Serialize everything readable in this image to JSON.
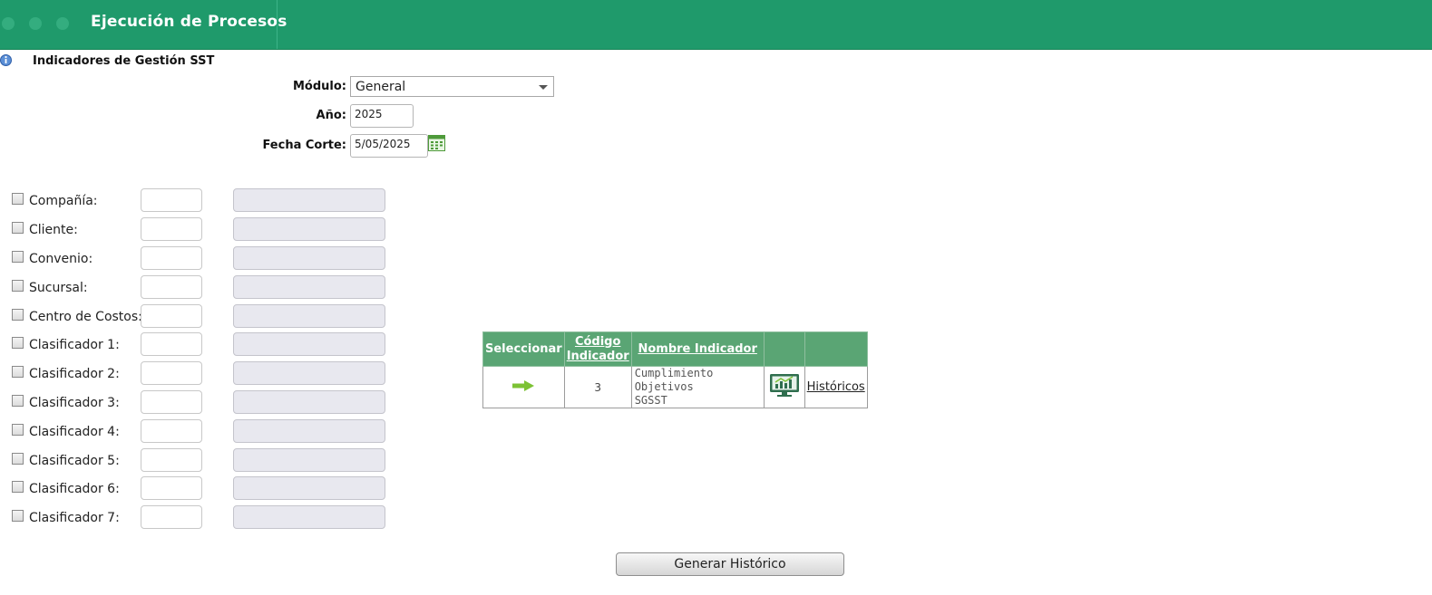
{
  "header": {
    "title": "Ejecución de Procesos"
  },
  "section": {
    "title": "Indicadores de Gestión SST"
  },
  "form": {
    "modulo_label": "Módulo:",
    "modulo_value": "General",
    "anio_label": "Año:",
    "anio_value": "2025",
    "fecha_label": "Fecha Corte:",
    "fecha_value": "5/05/2025"
  },
  "filters": [
    {
      "label": "Compañía:"
    },
    {
      "label": "Cliente:"
    },
    {
      "label": "Convenio:"
    },
    {
      "label": "Sucursal:"
    },
    {
      "label": "Centro de Costos:"
    },
    {
      "label": "Clasificador 1:"
    },
    {
      "label": "Clasificador 2:"
    },
    {
      "label": "Clasificador 3:"
    },
    {
      "label": "Clasificador 4:"
    },
    {
      "label": "Clasificador 5:"
    },
    {
      "label": "Clasificador 6:"
    },
    {
      "label": "Clasificador 7:"
    }
  ],
  "grid": {
    "headers": {
      "select": "Seleccionar",
      "code_line1": "Código",
      "code_line2": "Indicador",
      "name": "Nombre Indicador"
    },
    "rows": [
      {
        "code": "3",
        "name_line1": "Cumplimiento Objetivos",
        "name_line2": "SGSST",
        "history": "Históricos"
      }
    ]
  },
  "actions": {
    "generate": "Generar Histórico"
  },
  "colors": {
    "header_bg": "#1f9a6b",
    "grid_header_bg": "#5aa574",
    "arrow": "#7cc234"
  }
}
